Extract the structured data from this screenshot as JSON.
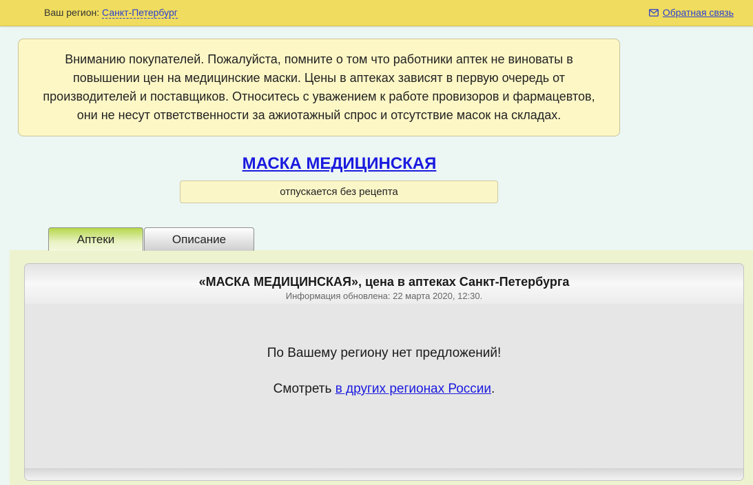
{
  "header": {
    "region_label": "Ваш регион:",
    "region_value": "Санкт-Петербург",
    "feedback_label": "Обратная связь"
  },
  "notice": {
    "text": "Вниманию покупателей. Пожалуйста, помните о том что работники аптек не виноваты в повышении цен на медицинские маски. Цены в аптеках зависят в первую очередь от производителей и поставщиков. Относитесь с уважением к работе провизоров и фармацевтов, они не несут ответственности за ажиотажный спрос и отсутствие масок на складах."
  },
  "product": {
    "title": "МАСКА МЕДИЦИНСКАЯ",
    "prescription": "отпускается без рецепта"
  },
  "tabs": [
    {
      "label": "Аптеки",
      "active": true
    },
    {
      "label": "Описание",
      "active": false
    }
  ],
  "panel": {
    "title": "«МАСКА МЕДИЦИНСКАЯ», цена в аптеках Санкт-Петербурга",
    "updated": "Информация обновлена: 22 марта 2020, 12:30.",
    "no_offers": "По Вашему региону нет предложений!",
    "see_prefix": "Смотреть",
    "see_link": "в других регионах России",
    "see_suffix": "."
  },
  "colors": {
    "topbar": "#f0dc5e",
    "page_bg": "#ecf6f2",
    "link": "#1a1adf",
    "active_tab": "#b6d84a"
  },
  "icons": {
    "feedback": "mail-icon"
  }
}
